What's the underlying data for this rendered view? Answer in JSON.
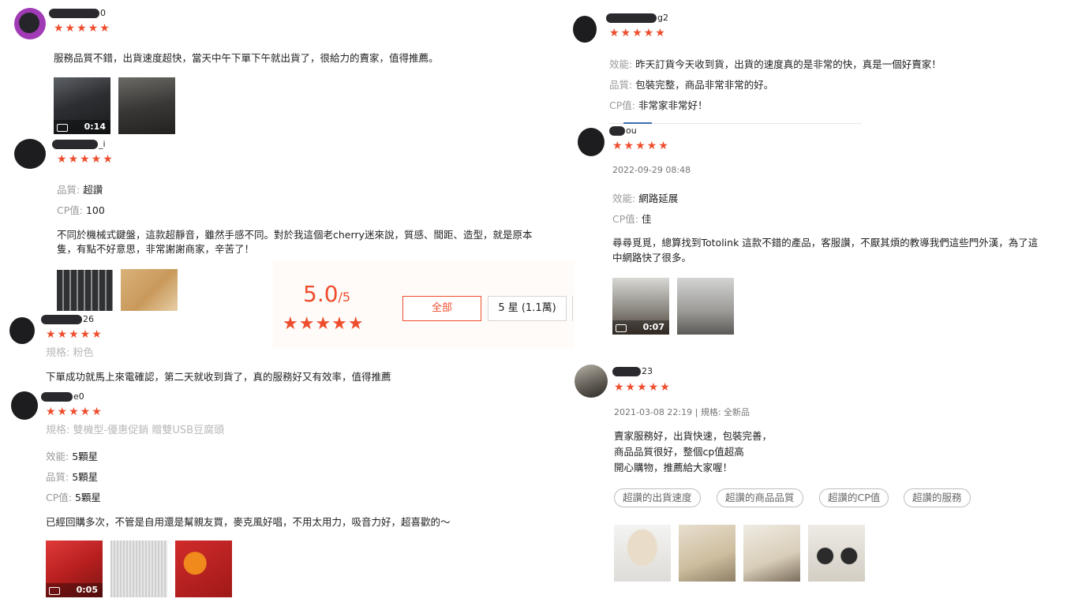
{
  "colors": {
    "accent": "#ee4d2d",
    "muted": "#9a9a9a"
  },
  "reviews": [
    {
      "user_suffix": "0",
      "stars": "★★★★★",
      "text": "服務品質不錯，出貨速度超快，當天中午下單下午就出貨了，很給力的賣家，值得推薦。",
      "video_duration": "0:14"
    },
    {
      "user_suffix": "_i",
      "stars": "★★★★★",
      "attr1_key": "品質:",
      "attr1_val": "超讚",
      "attr2_key": "CP值:",
      "attr2_val": "100",
      "text_line1": "不同於機械式鍵盤，這款超靜音，雖然手感不同。對於我這個老cherry迷來說，質感、間距、造型，就是原本",
      "text_line2": "隻，有點不好意思，非常謝謝商家，辛苦了！"
    },
    {
      "user_suffix": "26",
      "stars": "★★★★★",
      "variation": "規格: 粉色",
      "text": "下單成功就馬上來電確認，第二天就收到貨了，真的服務好又有效率，值得推薦"
    },
    {
      "user_suffix": "e0",
      "stars": "★★★★★",
      "variation": "規格: 雙機型-優惠促銷 贈雙USB豆腐頭",
      "attr1_key": "效能:",
      "attr1_val": "5顆星",
      "attr2_key": "品質:",
      "attr2_val": "5顆星",
      "attr3_key": "CP值:",
      "attr3_val": "5顆星",
      "text": "已經回購多次，不管是自用還是幫親友買，麥克風好唱，不用太用力，吸音力好，超喜歡的～",
      "video_duration": "0:05"
    },
    {
      "user_suffix": "g2",
      "stars": "★★★★★",
      "attr1_key": "效能:",
      "attr1_val": "昨天訂貨今天收到貨，出貨的速度真的是非常的快，真是一個好賣家！",
      "attr2_key": "品質:",
      "attr2_val": "包裝完整，商品非常非常的好。",
      "attr3_key": "CP值:",
      "attr3_val": "非常家非常好！"
    },
    {
      "user_suffix": "ou",
      "stars": "★★★★★",
      "date": "2022-09-29 08:48",
      "attr1_key": "效能:",
      "attr1_val": "網路延展",
      "attr2_key": "CP值:",
      "attr2_val": "佳",
      "text_line1": "尋尋覓覓，總算找到Totolink 這款不錯的產品，客服讚，不厭其煩的教導我們這些門外漢，為了這",
      "text_line2": "中網路快了很多。",
      "video_duration": "0:07"
    },
    {
      "user_suffix": "23",
      "stars": "★★★★★",
      "date": "2021-03-08 22:19 | 規格: 全新品",
      "text_line1": "賣家服務好，出貨快速，包裝完善，",
      "text_line2": "商品品質很好，整個cp值超高",
      "text_line3": "開心購物，推薦給大家喔！",
      "tags": [
        "超讚的出貨速度",
        "超讚的商品品質",
        "超讚的CP值",
        "超讚的服務"
      ]
    }
  ],
  "overview": {
    "score": "5.0",
    "score_suffix": "/5",
    "stars": "★★★★★",
    "filters": [
      "全部",
      "5 星 (1.1萬)"
    ]
  }
}
